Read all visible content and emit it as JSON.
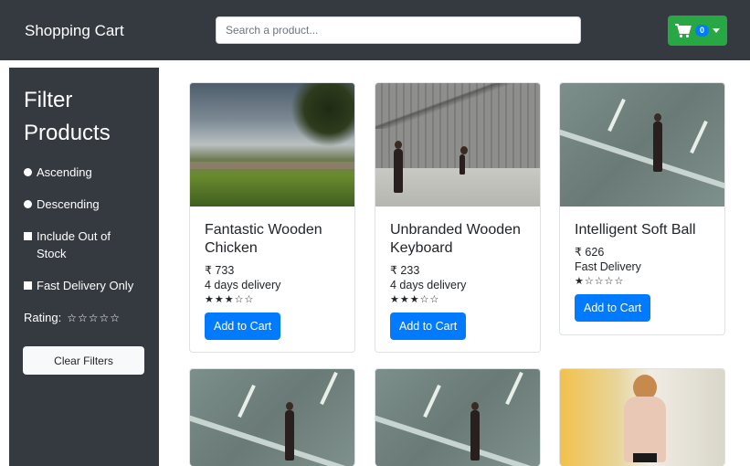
{
  "navbar": {
    "brand": "Shopping Cart",
    "search_placeholder": "Search a product...",
    "cart_count": "0",
    "cart_icon": "shopping-cart-icon"
  },
  "sidebar": {
    "title": "Filter Products",
    "options": {
      "ascending": "Ascending",
      "descending": "Descending",
      "out_of_stock": "Include Out of Stock",
      "fast_delivery": "Fast Delivery Only"
    },
    "rating_label": "Rating:",
    "rating_value": 0,
    "rating_max": 5,
    "clear_label": "Clear Filters"
  },
  "products": [
    {
      "name": "Fantastic Wooden Chicken",
      "price": "₹ 733",
      "delivery": "4 days delivery",
      "rating": 3,
      "button": "Add to Cart"
    },
    {
      "name": "Unbranded Wooden Keyboard",
      "price": "₹ 233",
      "delivery": "4 days delivery",
      "rating": 3,
      "button": "Add to Cart"
    },
    {
      "name": "Intelligent Soft Ball",
      "price": "₹ 626",
      "delivery": "Fast Delivery",
      "rating": 1,
      "button": "Add to Cart"
    }
  ],
  "colors": {
    "navbar_bg": "#343a40",
    "cart_btn": "#28a745",
    "primary": "#007bff",
    "sidebar_bg": "#343a40"
  }
}
